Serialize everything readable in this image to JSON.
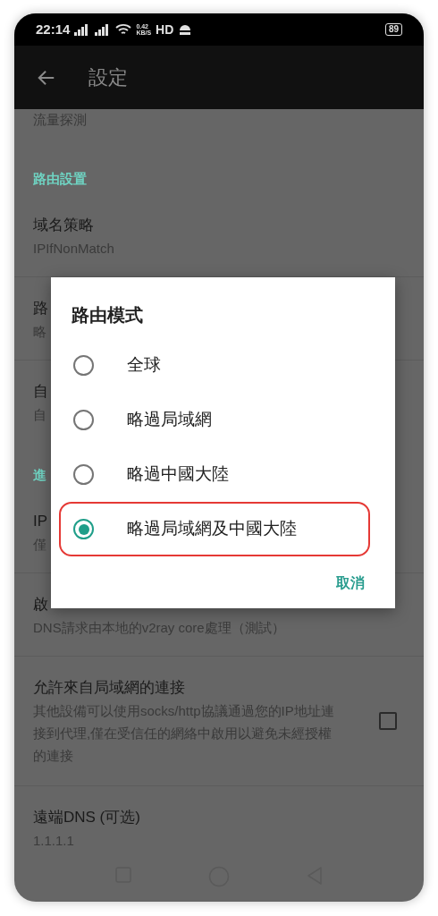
{
  "status_bar": {
    "time": "22:14",
    "speed_value": "0.42",
    "speed_unit": "KB/S",
    "hd": "HD",
    "battery": "89"
  },
  "app_bar": {
    "title": "設定"
  },
  "settings": [
    {
      "kind": "summary",
      "text": "流量探測"
    },
    {
      "kind": "section",
      "title": "路由設置"
    },
    {
      "kind": "pref",
      "title": "域名策略",
      "summary": "IPIfNonMatch"
    },
    {
      "kind": "pref",
      "title": "路",
      "summary": "略"
    },
    {
      "kind": "pref",
      "title": "自",
      "summary": "自"
    },
    {
      "kind": "section",
      "title": "進"
    },
    {
      "kind": "pref",
      "title": "IP",
      "summary": "僅"
    },
    {
      "kind": "pref",
      "title": "啟",
      "summary": "DNS請求由本地的v2ray core處理（測試）"
    },
    {
      "kind": "checkbox",
      "title": "允許來自局域網的連接",
      "summary": "其他設備可以使用socks/http協議通過您的IP地址連接到代理,僅在受信任的網絡中啟用以避免未經授權的連接",
      "checked": false
    },
    {
      "kind": "pref",
      "title": "遠端DNS (可选)",
      "summary": "1.1.1.1"
    }
  ],
  "dialog": {
    "title": "路由模式",
    "options": [
      {
        "label": "全球",
        "selected": false,
        "highlighted": false
      },
      {
        "label": "略過局域網",
        "selected": false,
        "highlighted": false
      },
      {
        "label": "略過中國大陸",
        "selected": false,
        "highlighted": false
      },
      {
        "label": "略過局域網及中國大陸",
        "selected": true,
        "highlighted": true
      }
    ],
    "cancel": "取消"
  }
}
